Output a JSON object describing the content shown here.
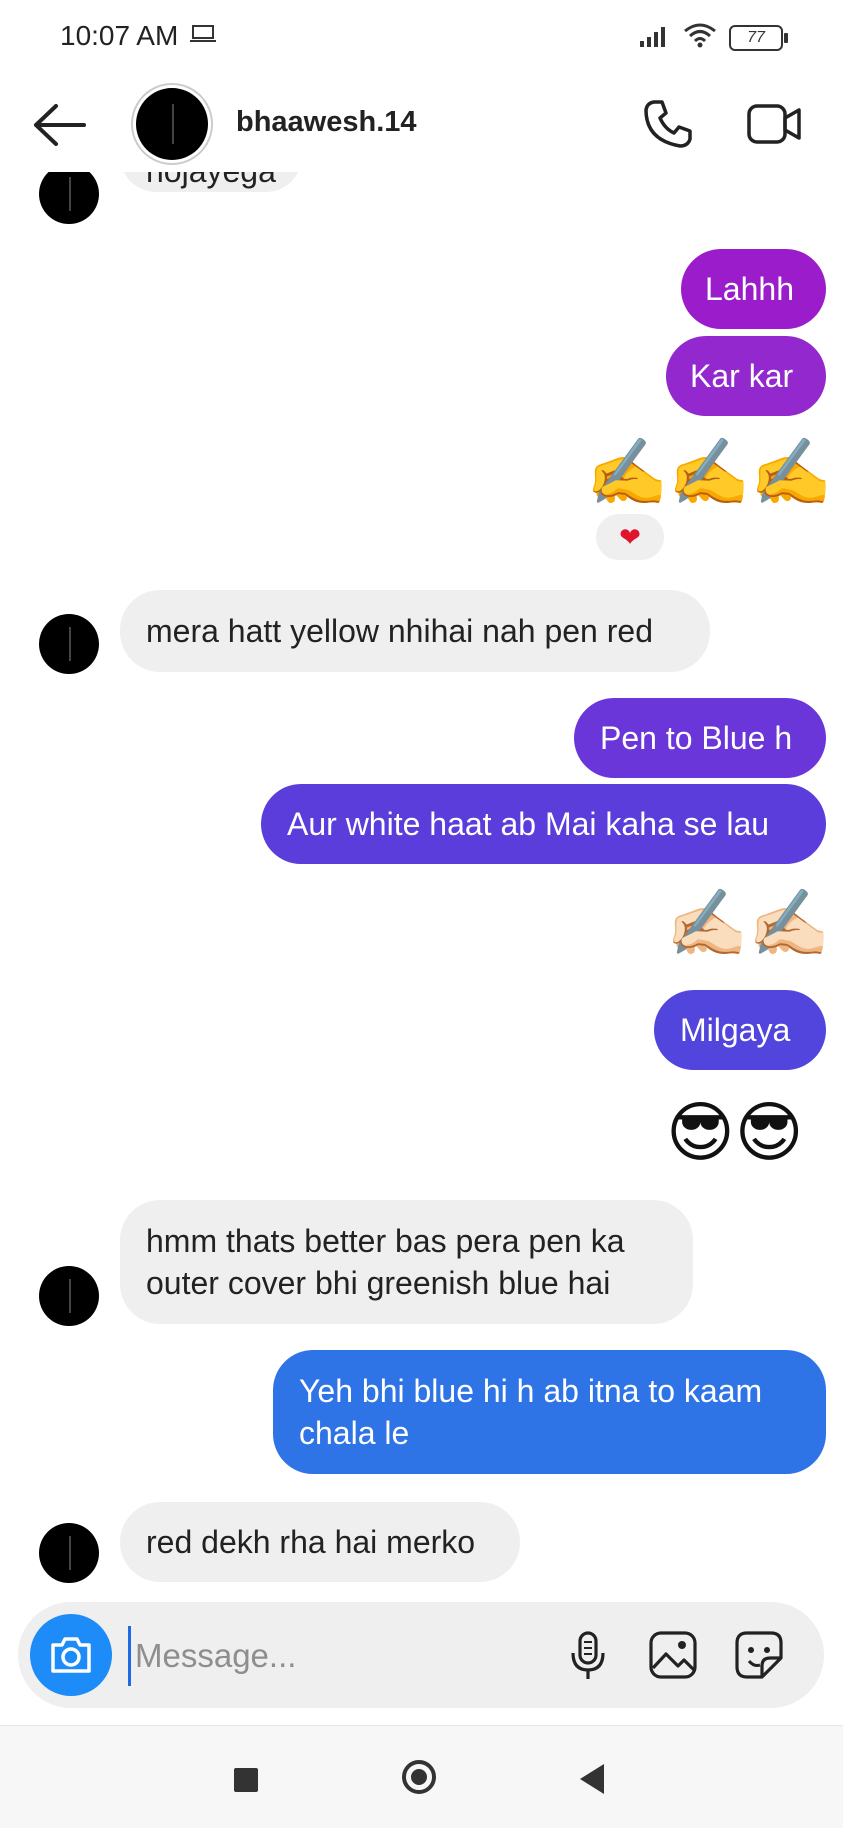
{
  "status": {
    "time": "10:07 AM",
    "battery": "77"
  },
  "header": {
    "username": "bhaawesh.14"
  },
  "messages": {
    "m0": "hojayega",
    "m1": "Lahhh",
    "m2": "Kar kar",
    "m3": "✍️✍️✍️",
    "m3_reaction": "❤",
    "m4": "mera hatt yellow nhihai nah pen red",
    "m5": "Pen to Blue h",
    "m6": "Aur white haat ab Mai kaha se lau",
    "m7": "✍🏻✍🏻",
    "m8": "Milgaya",
    "m9": "😎😎",
    "m10_line1": "hmm thats better bas pera pen ka",
    "m10_line2": "outer cover bhi greenish blue hai",
    "m11_line1": "Yeh bhi blue hi h ab itna to kaam",
    "m11_line2": "chala le",
    "m12": "red dekh rha hai merko"
  },
  "composer": {
    "placeholder": "Message..."
  },
  "colors": {
    "bubble_purple": "#9a1ccb",
    "bubble_violet": "#6a36d9",
    "bubble_indigo": "#5145dd",
    "bubble_blue": "#2f74e6",
    "bubble_incoming": "#efefef",
    "camera_button": "#1d8cf8"
  },
  "icons": [
    "back-arrow-icon",
    "phone-icon",
    "video-call-icon",
    "camera-icon",
    "microphone-icon",
    "gallery-icon",
    "sticker-icon"
  ]
}
